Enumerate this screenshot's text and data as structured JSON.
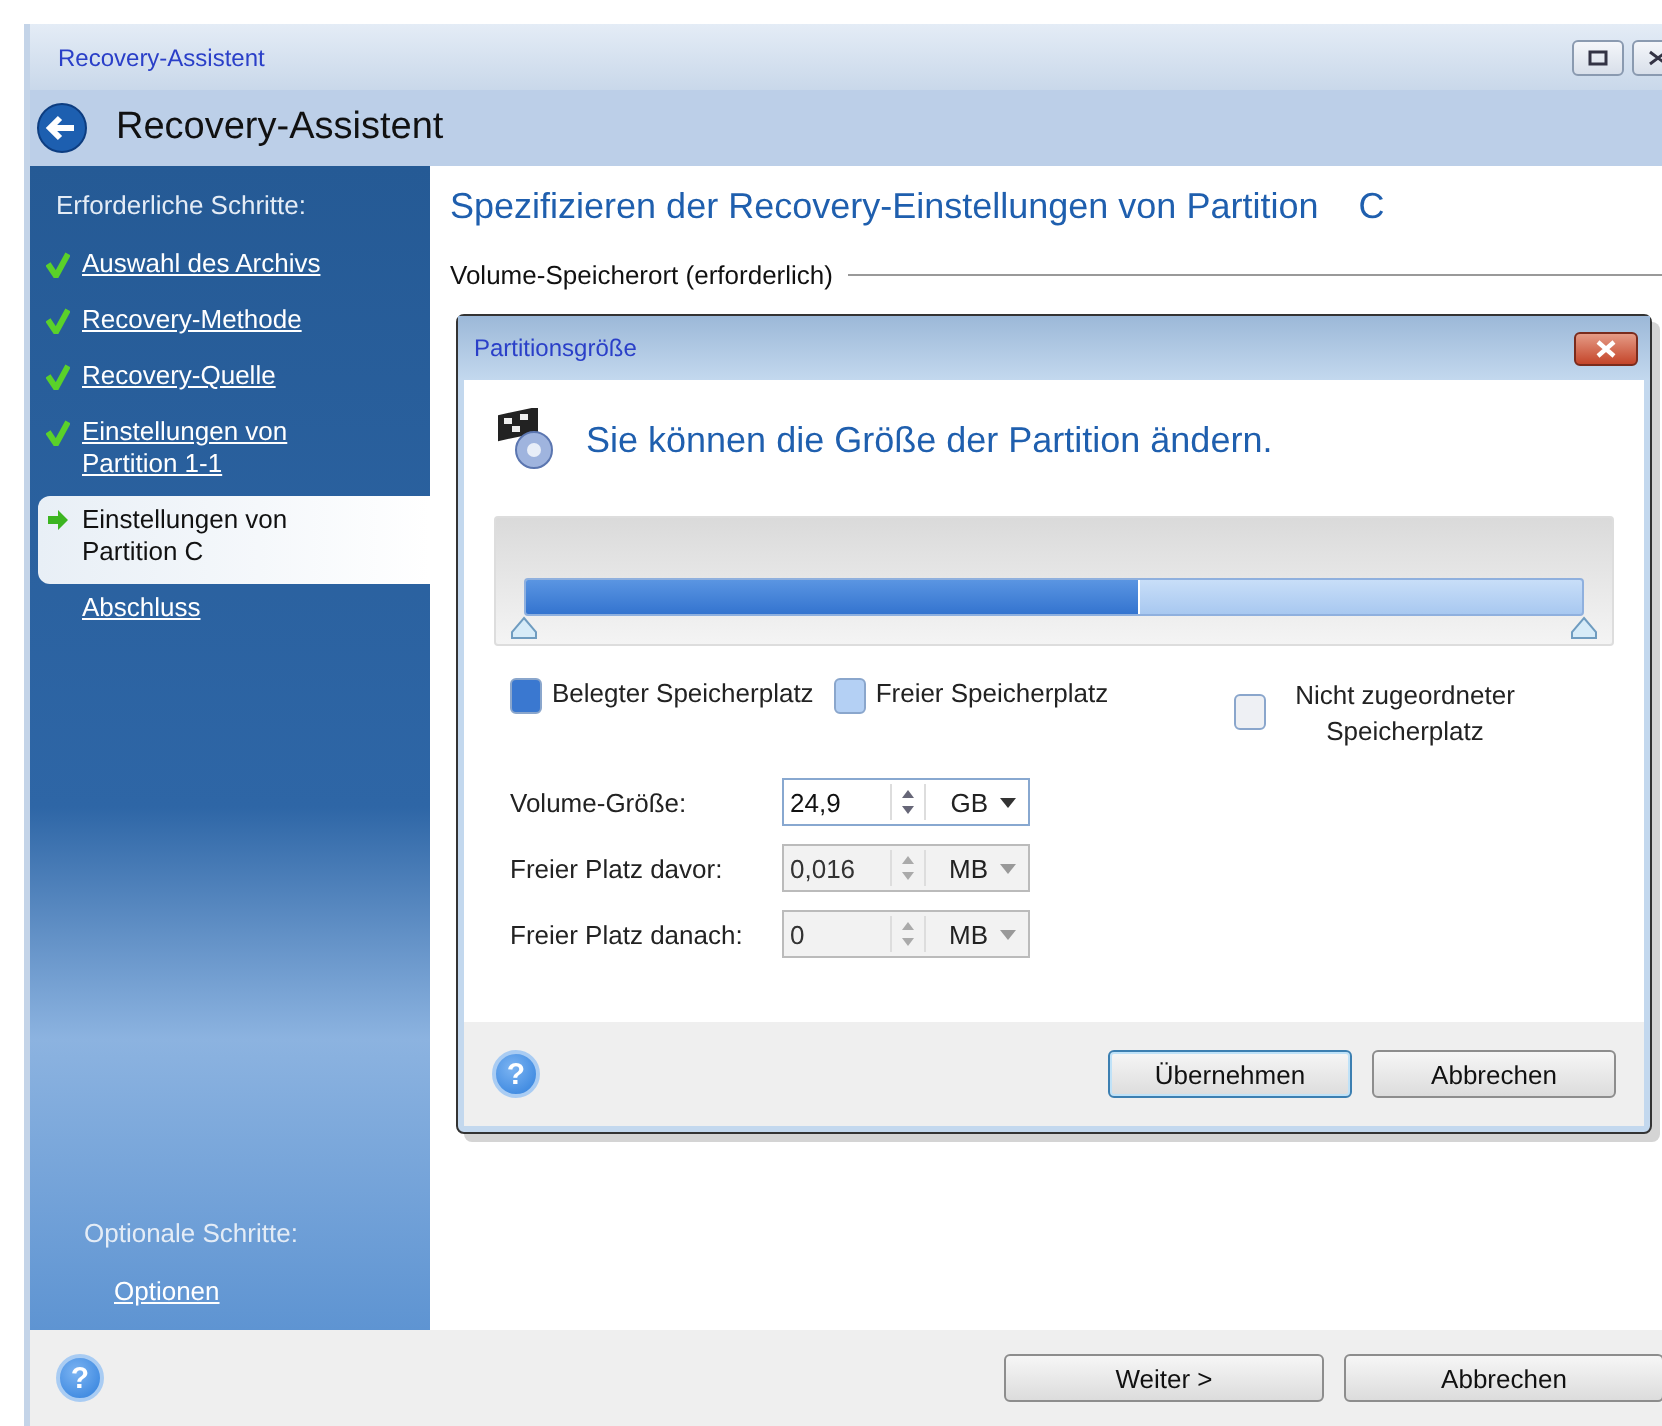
{
  "window": {
    "title": "Recovery-Assistent",
    "header": "Recovery-Assistent"
  },
  "sidebar": {
    "required_heading": "Erforderliche Schritte:",
    "steps": [
      {
        "label": "Auswahl des Archivs",
        "done": true,
        "selected": false
      },
      {
        "label": "Recovery-Methode",
        "done": true,
        "selected": false
      },
      {
        "label": "Recovery-Quelle",
        "done": true,
        "selected": false
      },
      {
        "label": "Einstellungen von Partition 1-1",
        "done": true,
        "selected": false
      },
      {
        "label": "Einstellungen von Partition C",
        "done": false,
        "selected": true
      },
      {
        "label": "Abschluss",
        "done": false,
        "selected": false
      }
    ],
    "optional_heading": "Optionale Schritte:",
    "optional_steps": [
      {
        "label": "Optionen"
      }
    ]
  },
  "main": {
    "heading": "Spezifizieren der Recovery-Einstellungen von Partition    C",
    "section_label": "Volume-Speicherort (erforderlich)"
  },
  "dialog": {
    "title": "Partitionsgröße",
    "heading": "Sie können die Größe der Partition ändern.",
    "partition_bar": {
      "level": 0.58
    },
    "legend": [
      {
        "label": "Belegter Speicherplatz",
        "color": "#3a78d0"
      },
      {
        "label": "Freier Speicherplatz",
        "color": "#b4d0f4"
      },
      {
        "label": "Nicht zugeordneter Speicherplatz",
        "color": "#eef0f4"
      }
    ],
    "fields": [
      {
        "label": "Volume-Größe:",
        "value": "24,9",
        "unit": "GB",
        "disabled": false
      },
      {
        "label": "Freier Platz davor:",
        "value": "0,016",
        "unit": "MB",
        "disabled": true
      },
      {
        "label": "Freier Platz danach:",
        "value": "0",
        "unit": "MB",
        "disabled": true
      }
    ],
    "help_button": "?",
    "buttons": [
      {
        "label": "Übernehmen",
        "default": true
      },
      {
        "label": "Abbrechen",
        "default": false
      }
    ]
  },
  "footer": {
    "help_button": "?",
    "buttons": [
      {
        "label": "Weiter >"
      },
      {
        "label": "Abbrechen"
      }
    ]
  }
}
